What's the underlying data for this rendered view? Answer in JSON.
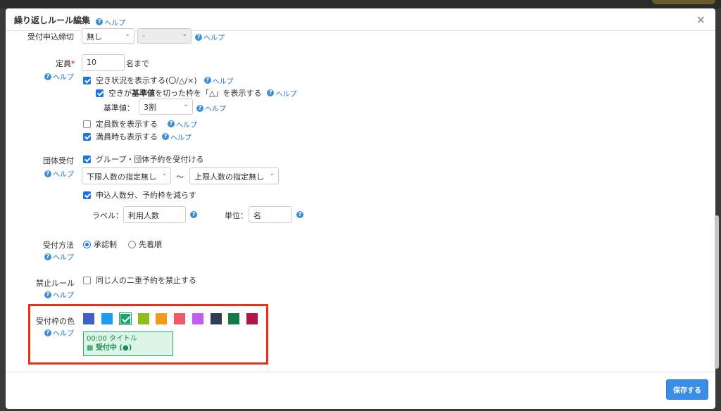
{
  "dialog": {
    "title": "繰り返しルール編集",
    "help": "ヘルプ",
    "close": "×"
  },
  "deadline": {
    "label": "受付申込締切",
    "select1": "無し",
    "select2": "-",
    "help": "ヘルプ"
  },
  "capacity": {
    "label": "定員",
    "required_mark": "*",
    "help": "ヘルプ",
    "value": "10",
    "suffix": "名まで",
    "show_status_label": "空き状況を表示する(〇/△/×)",
    "show_status_help": "ヘルプ",
    "threshold_prefix": "空きが",
    "threshold_bold": "基準値",
    "threshold_suffix": "を切った枠を「△」を表示する",
    "threshold_help": "ヘルプ",
    "base_label": "基準値：",
    "base_value": "3割",
    "base_help": "ヘルプ",
    "show_count_label": "定員数を表示する",
    "show_count_help": "ヘルプ",
    "show_full_label": "満員時も表示する",
    "show_full_help": "ヘルプ"
  },
  "group": {
    "label": "団体受付",
    "help": "ヘルプ",
    "accept_label": "グループ・団体予約を受付ける",
    "min_value": "下限人数の指定無し",
    "tilde": "〜",
    "max_value": "上限人数の指定無し",
    "reduce_label": "申込人数分、予約枠を減らす",
    "label_prefix": "ラベル：",
    "label_value": "利用人数",
    "unit_prefix": "単位：",
    "unit_value": "名"
  },
  "method": {
    "label": "受付方法",
    "help": "ヘルプ",
    "option1": "承認制",
    "option2": "先着順"
  },
  "ban": {
    "label": "禁止ルール",
    "help": "ヘルプ",
    "option": "同じ人の二重予約を禁止する"
  },
  "color": {
    "label": "受付枠の色",
    "help": "ヘルプ",
    "swatches": [
      "#3a62c8",
      "#1b9df0",
      "#1aa66b",
      "#8fbe1c",
      "#f59a18",
      "#ee5a66",
      "#c45cf0",
      "#2f3e57",
      "#167a44",
      "#b3124a"
    ],
    "selected_index": 2,
    "preview_line1": "00:00 タイトル",
    "preview_line2": "受付中 (●)"
  },
  "footer": {
    "save": "保存する"
  }
}
